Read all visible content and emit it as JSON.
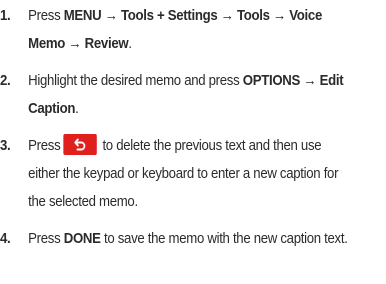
{
  "steps": [
    {
      "number": "1.",
      "prefix": "Press ",
      "path": "MENU → Tools + Settings → Tools → Voice Memo → Review",
      "suffix": "."
    },
    {
      "number": "2.",
      "prefix": "Highlight the desired memo and press ",
      "path": "OPTIONS → Edit Caption",
      "suffix": "."
    },
    {
      "number": "3.",
      "prefix": "Press",
      "icon": "back-arrow-icon",
      "icon_color": "#e0201c",
      "suffix": " to delete the previous text and then use either the keypad or keyboard to enter a new caption for the selected memo."
    },
    {
      "number": "4.",
      "prefix": "Press ",
      "key": "DONE",
      "suffix": " to save the memo with the new caption text."
    }
  ]
}
